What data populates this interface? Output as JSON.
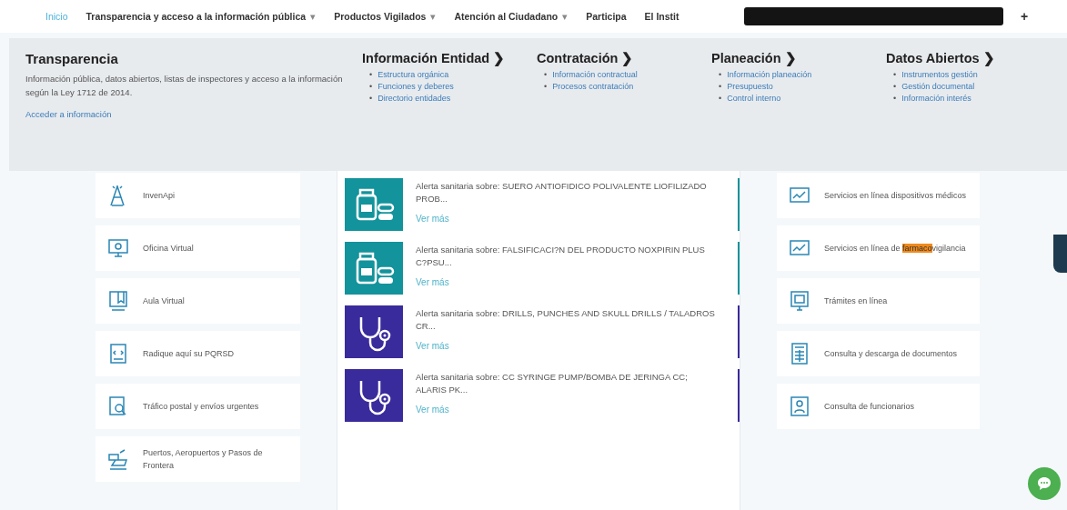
{
  "nav": {
    "items": [
      {
        "label": "Inicio",
        "selected": true
      },
      {
        "label": "Transparencia y acceso a la información pública",
        "selected": false,
        "caret": "▾"
      },
      {
        "label": "Productos Vigilados",
        "selected": false,
        "caret": "▾"
      },
      {
        "label": "Atención al Ciudadano",
        "selected": false,
        "caret": "▾"
      },
      {
        "label": "Participa",
        "selected": false
      },
      {
        "label": "El Instit",
        "selected": false
      }
    ],
    "more": "+"
  },
  "mega_menu": {
    "title": "Transparencia",
    "description": "Información pública, datos abiertos, listas de inspectores y acceso a la información según la Ley 1712 de 2014.",
    "link": "Acceder a información",
    "columns": [
      {
        "heading": "Información Entidad",
        "arrow": "❯",
        "links": [
          {
            "bullet": "•",
            "text": "Estructura orgánica"
          },
          {
            "bullet": "•",
            "text": "Funciones y deberes"
          },
          {
            "bullet": "•",
            "text": "Directorio entidades"
          }
        ]
      },
      {
        "heading": "Contratación",
        "arrow": "❯",
        "links": [
          {
            "bullet": "•",
            "text": "Información contractual"
          },
          {
            "bullet": "•",
            "text": "Procesos contratación"
          }
        ]
      },
      {
        "heading": "Planeación",
        "arrow": "❯",
        "links": [
          {
            "bullet": "•",
            "text": "Información planeación"
          },
          {
            "bullet": "•",
            "text": "Presupuesto"
          },
          {
            "bullet": "•",
            "text": "Control interno"
          }
        ]
      },
      {
        "heading": "Datos Abiertos",
        "arrow": "❯",
        "links": [
          {
            "bullet": "•",
            "text": "Instrumentos gestión"
          },
          {
            "bullet": "•",
            "text": "Gestión documental"
          },
          {
            "bullet": "•",
            "text": "Información interés"
          }
        ]
      }
    ]
  },
  "left_services": [
    {
      "kind": "antenna",
      "label": "InvenApi"
    },
    {
      "kind": "monitor",
      "label": "Oficina Virtual"
    },
    {
      "kind": "classroom",
      "label": "Aula Virtual"
    },
    {
      "kind": "document",
      "label": "Radique aquí su PQRSD"
    },
    {
      "kind": "search",
      "label": "Tráfico postal y envíos urgentes"
    },
    {
      "kind": "port",
      "label": "Puertos, Aeropuertos y Pasos de Frontera"
    }
  ],
  "alerts": [
    {
      "kind": "medicine",
      "color": "#13939b",
      "text": "Alerta sanitaria sobre: SUERO ANTIOFIDICO POLIVALENTE LIOFILIZADO PROB...",
      "link": "Ver más"
    },
    {
      "kind": "medicine",
      "color": "#13939b",
      "text": "Alerta sanitaria sobre: FALSIFICACI?N DEL PRODUCTO NOXPIRIN PLUS C?PSU...",
      "link": "Ver más"
    },
    {
      "kind": "device",
      "color": "#3a2b9c",
      "text": "Alerta sanitaria sobre: DRILLS, PUNCHES AND SKULL DRILLS / TALADROS CR...",
      "link": "Ver más"
    },
    {
      "kind": "device",
      "color": "#3a2b9c",
      "text": "Alerta sanitaria sobre: CC SYRINGE PUMP/BOMBA DE JERINGA CC; ALARIS PK...",
      "link": "Ver más"
    }
  ],
  "right_services": [
    {
      "kind": "chart",
      "parts": [
        {
          "text": "Servicios en línea dispositivos médicos",
          "highlighted": false
        }
      ]
    },
    {
      "kind": "chart",
      "parts": [
        {
          "text": "Servicios en línea de ",
          "highlighted": false
        },
        {
          "text": "farmaco",
          "highlighted": true
        },
        {
          "text": "vigilancia",
          "highlighted": false
        }
      ]
    },
    {
      "kind": "screen",
      "parts": [
        {
          "text": "Trámites en línea",
          "highlighted": false
        }
      ]
    },
    {
      "kind": "calculator",
      "parts": [
        {
          "text": "Consulta y descarga de documentos",
          "highlighted": false
        }
      ]
    },
    {
      "kind": "person",
      "parts": [
        {
          "text": "Consulta de funcionarios",
          "highlighted": false
        }
      ]
    }
  ]
}
